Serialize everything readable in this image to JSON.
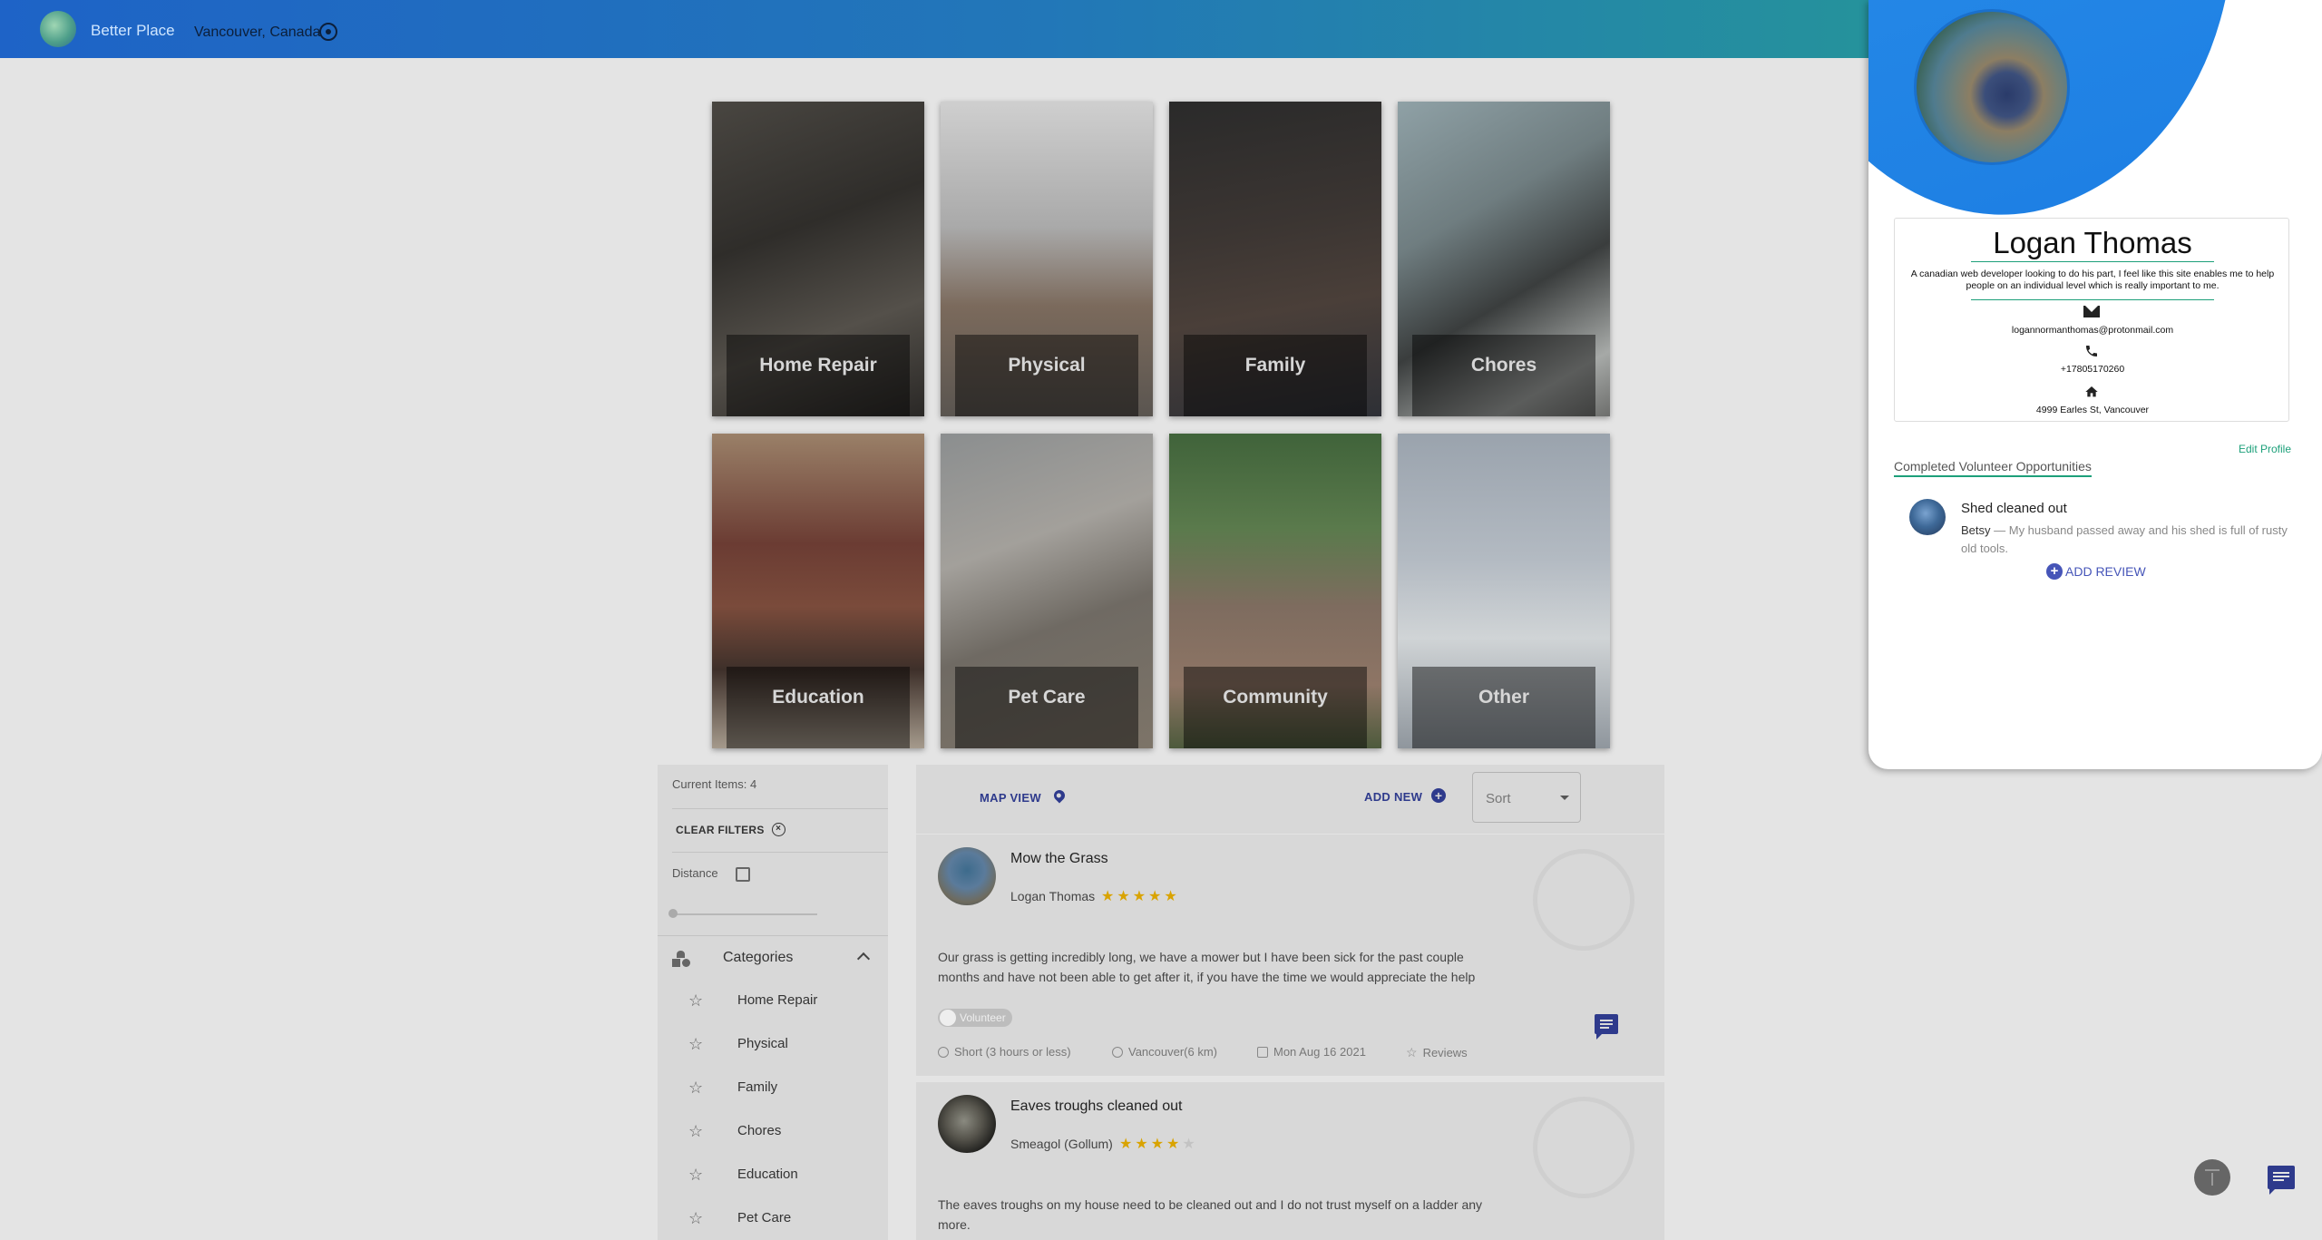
{
  "header": {
    "brand": "Better Place",
    "location": "Vancouver, Canada"
  },
  "categories_tiles": [
    {
      "label": "Home Repair"
    },
    {
      "label": "Physical"
    },
    {
      "label": "Family"
    },
    {
      "label": "Chores"
    },
    {
      "label": "Education"
    },
    {
      "label": "Pet Care"
    },
    {
      "label": "Community"
    },
    {
      "label": "Other"
    }
  ],
  "filters": {
    "current_items": "Current Items: 4",
    "clear_filters": "CLEAR FILTERS",
    "distance_label": "Distance",
    "categories_title": "Categories",
    "category_items": [
      "Home Repair",
      "Physical",
      "Family",
      "Chores",
      "Education",
      "Pet Care"
    ]
  },
  "list_header": {
    "map_view": "MAP VIEW",
    "add_new": "ADD NEW",
    "sort_placeholder": "Sort"
  },
  "listings": [
    {
      "title": "Mow the Grass",
      "author": "Logan Thomas",
      "rating": 5,
      "description": "Our grass is getting incredibly long, we have a mower but I have been sick for the past couple months and have not been able to get after it, if you have the time we would appreciate the help",
      "toggle_label": "Volunteer",
      "duration": "Short (3 hours or less)",
      "distance": "Vancouver(6 km)",
      "date": "Mon Aug 16 2021",
      "reviews": "Reviews"
    },
    {
      "title": "Eaves troughs cleaned out",
      "author": "Smeagol (Gollum)",
      "rating": 4,
      "description": "The eaves troughs on my house need to be cleaned out and I do not trust myself on a ladder any more."
    }
  ],
  "profile": {
    "name": "Logan Thomas",
    "bio": "A canadian web developer looking to do his part, I feel like this site enables me to help people on an individual level which is really important to me.",
    "email": "logannormanthomas@protonmail.com",
    "phone": "+17805170260",
    "address": "4999 Earles St, Vancouver",
    "edit_profile": "Edit Profile",
    "completed_title": "Completed Volunteer Opportunities",
    "completed": [
      {
        "title": "Shed cleaned out",
        "author": "Betsy",
        "description": " — My husband passed away and his shed is full of rusty old tools.",
        "action": "ADD REVIEW"
      }
    ]
  },
  "colors": {
    "appbar_start": "#1e63c7",
    "appbar_end": "#27a18c",
    "accent": "#2e3a8c",
    "green": "#1da07a",
    "star": "#d9a300"
  },
  "icons": [
    "globe-logo-icon",
    "my-location-icon",
    "pin-icon",
    "plus-circle-icon",
    "star-icon",
    "chat-icon",
    "clock-icon",
    "calendar-icon",
    "mail-icon",
    "phone-icon",
    "home-icon",
    "scroll-top-icon"
  ]
}
